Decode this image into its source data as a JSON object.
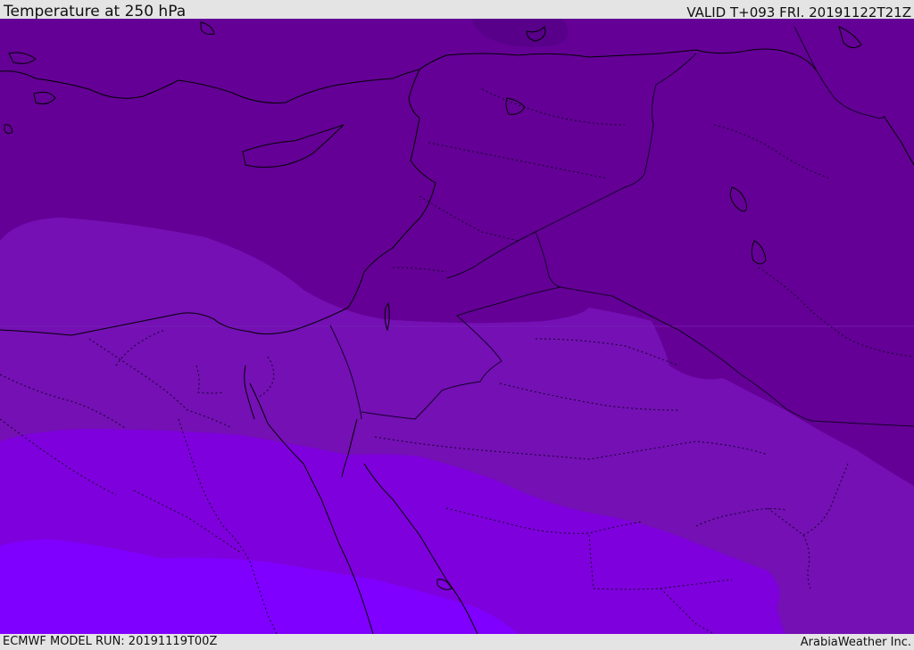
{
  "header": {
    "title": "Temperature at 250 hPa",
    "valid": "VALID T+093 FRI. 20191122T21Z"
  },
  "footer": {
    "model_run": "ECMWF MODEL RUN: 20191119T00Z",
    "credit": "ArabiaWeather Inc."
  },
  "map": {
    "colors": {
      "band_darkest": "#5a0088",
      "band_dark": "#640096",
      "band_mid": "#7410b4",
      "band_violet": "#7e00dc",
      "band_bright": "#7f00ff",
      "coastline": "#000000",
      "border": "#1a0030"
    }
  }
}
